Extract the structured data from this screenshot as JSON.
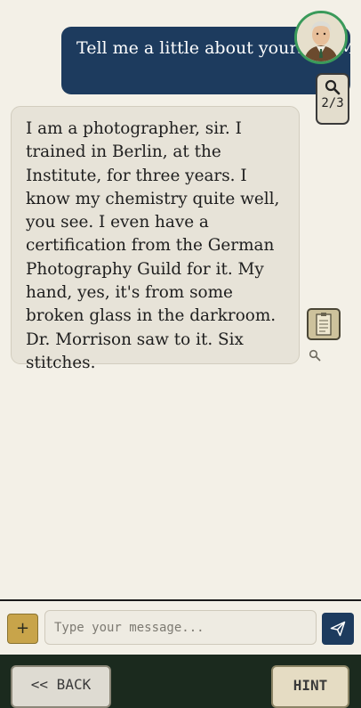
{
  "conversation": {
    "user_message": "Tell me a little about yourself, Mr. Mueller.",
    "npc_message": "I am a photographer, sir. I trained in Berlin, at the Institute, for three years. I know my chemistry quite well, you see. I even have a certification from the German Photography Guild for it. My hand, yes, it's from some broken glass in the darkroom. Dr. Morrison saw to it. Six stitches."
  },
  "clues": {
    "counter": "2/3",
    "icon": "magnifying-glass-icon"
  },
  "side_tools": {
    "notes_icon": "notepad-icon",
    "search_icon": "magnifying-glass-icon"
  },
  "composer": {
    "plus_label": "+",
    "placeholder": "Type your message...",
    "send_icon": "send-icon"
  },
  "footer": {
    "back_label": "<< BACK",
    "hint_label": "HINT"
  },
  "colors": {
    "background": "#f3f0e7",
    "user_bubble": "#1d3b5e",
    "npc_bubble": "#e7e3d8",
    "avatar_ring": "#3a9a5a",
    "footer": "#1b2a1e",
    "plus_button": "#c8a44a"
  }
}
